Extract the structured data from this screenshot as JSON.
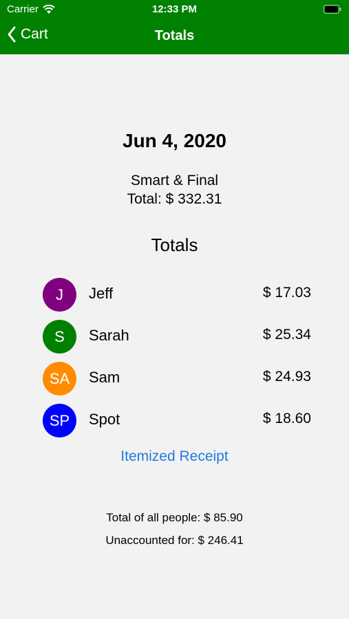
{
  "status_bar": {
    "carrier": "Carrier",
    "time": "12:33 PM",
    "wifi_icon": "wifi-icon",
    "battery_icon": "battery-icon"
  },
  "nav": {
    "back_label": "Cart",
    "title": "Totals",
    "back_icon": "chevron-left-icon"
  },
  "receipt": {
    "date": "Jun 4, 2020",
    "store": "Smart & Final",
    "total": "Total: $ 332.31"
  },
  "totals_section": {
    "title": "Totals",
    "people": [
      {
        "initials": "J",
        "name": "Jeff",
        "amount": "$ 17.03",
        "color": "#800080"
      },
      {
        "initials": "S",
        "name": "Sarah",
        "amount": "$ 25.34",
        "color": "#008000"
      },
      {
        "initials": "SA",
        "name": "Sam",
        "amount": "$ 24.93",
        "color": "#ff8c00"
      },
      {
        "initials": "SP",
        "name": "Spot",
        "amount": "$ 18.60",
        "color": "#0000ff"
      }
    ]
  },
  "itemized_link": "Itemized Receipt",
  "summary": {
    "total_all": "Total of all people: $ 85.90",
    "unaccounted": "Unaccounted for: $ 246.41"
  },
  "colors": {
    "header": "#018101",
    "background": "#f2f2f2",
    "link": "#1f7ae0"
  }
}
